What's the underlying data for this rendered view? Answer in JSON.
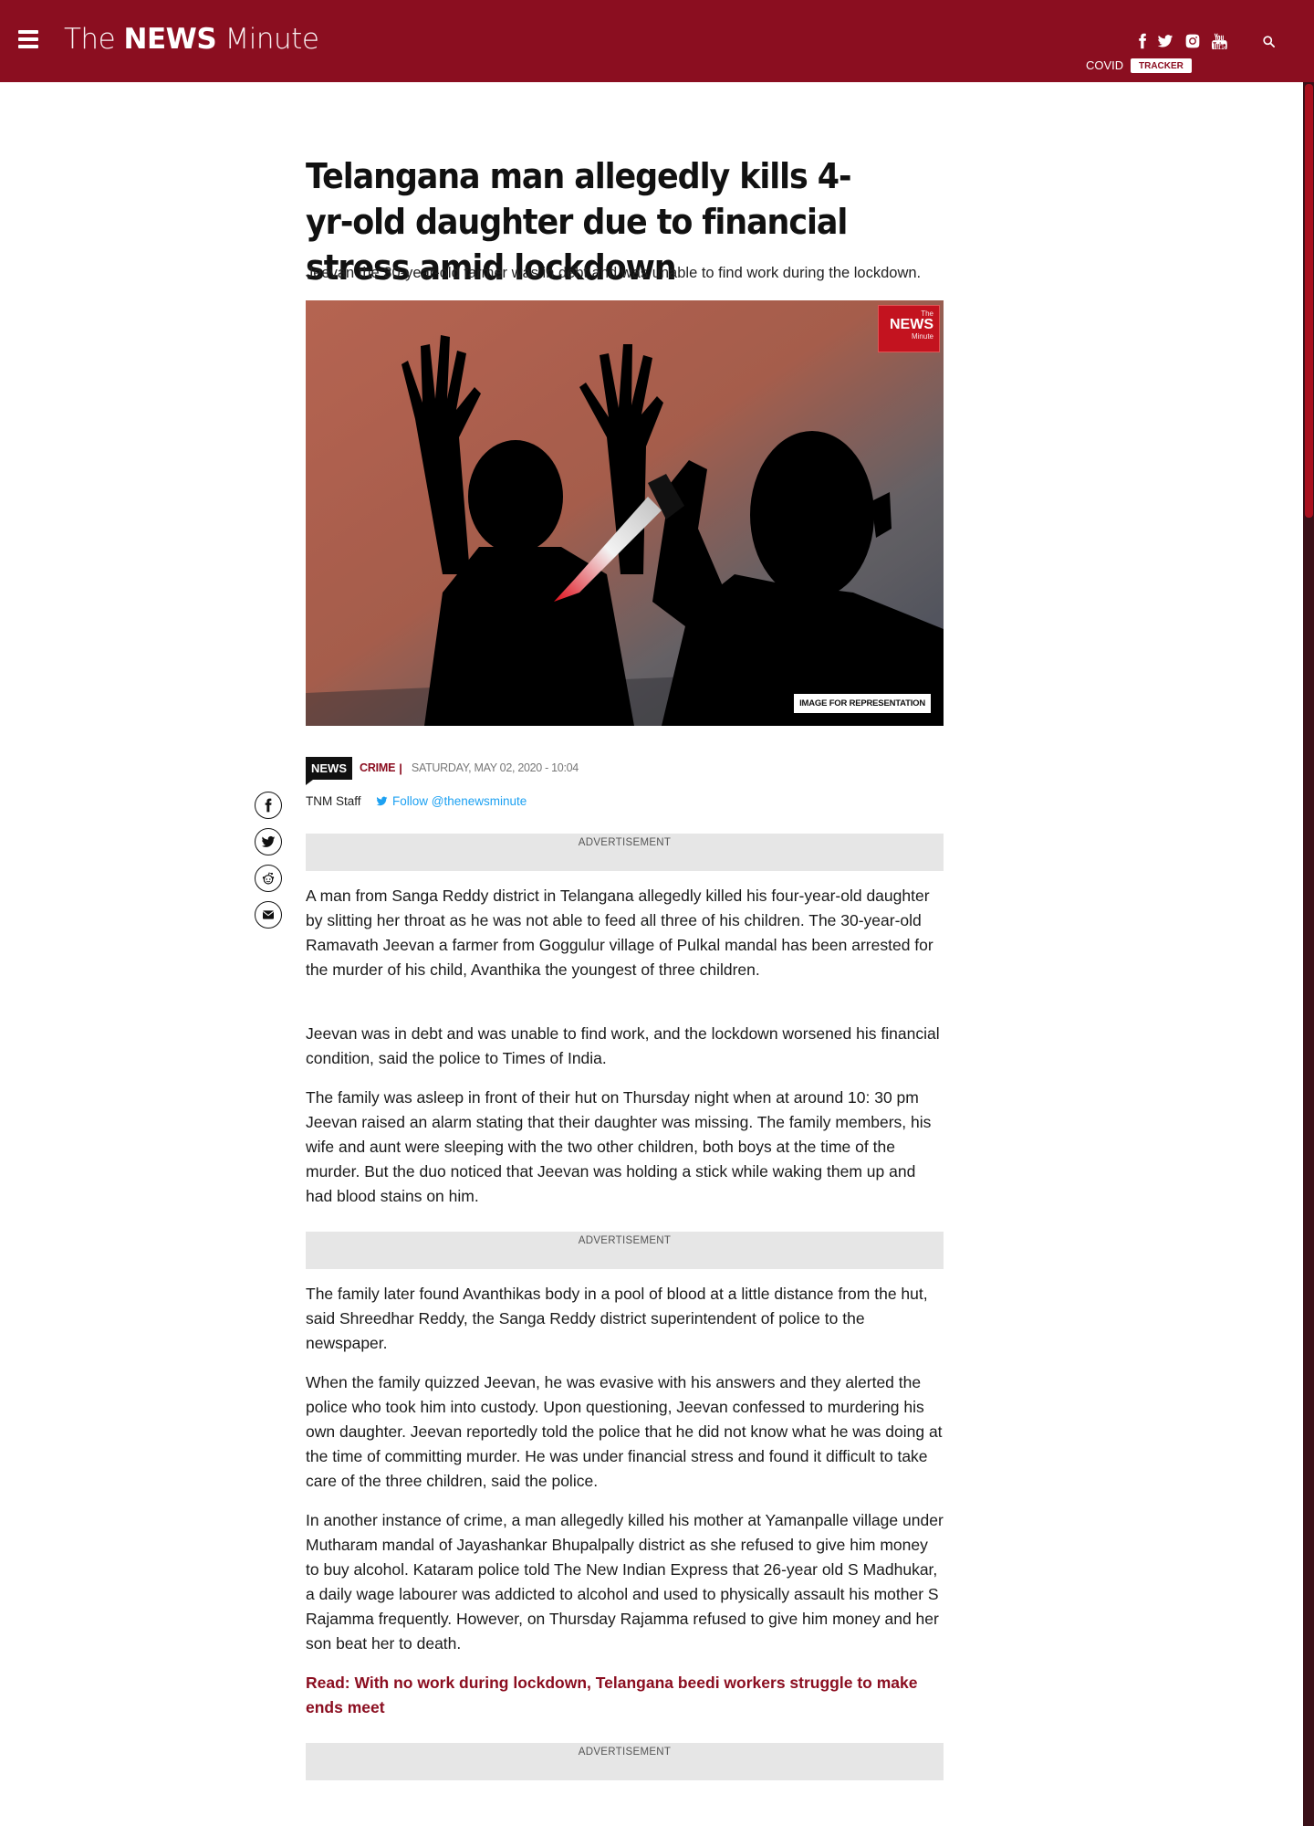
{
  "header": {
    "logo_the": "The",
    "logo_news": "NEWS",
    "logo_minute": "Minute",
    "covid_label": "COVID",
    "tracker_label": "TRACKER",
    "social_icons": [
      "facebook-icon",
      "twitter-icon",
      "instagram-icon",
      "youtube-icon"
    ],
    "search_icon": "search-icon",
    "menu_icon": "hamburger-menu-icon",
    "brand_color": "#8b0e20"
  },
  "article": {
    "headline": "Telangana man allegedly kills 4-yr-old daughter due to financial stress amid lockdown",
    "subhead": "Jeevan the 30-year-old farmer was in debt and was unable to find work during the lockdown.",
    "image_caption": "IMAGE FOR REPRESENTATION",
    "watermark_the": "The",
    "watermark_news": "NEWS",
    "watermark_minute": "Minute",
    "badge": "NEWS",
    "category": "CRIME",
    "separator": "|",
    "date": "SATURDAY, MAY 02, 2020 - 10:04",
    "author": "TNM Staff",
    "follow": "Follow @thenewsminute",
    "ad_label": "ADVERTISEMENT",
    "paragraphs": [
      "A man from Sanga Reddy district in Telangana allegedly killed his four-year-old daughter by slitting her throat as he was not able to feed all three of his children. The 30-year-old Ramavath Jeevan a farmer from Goggulur village of Pulkal mandal has been arrested for the murder of his child, Avanthika the youngest of three children.",
      "Jeevan was in debt and was unable to find work, and the lockdown worsened his financial condition, said the police to Times of India.",
      "The family was asleep in front of their hut on Thursday night when at around 10: 30 pm Jeevan raised an alarm stating that their daughter was missing. The family members, his wife and aunt were sleeping with the two other children, both boys at the time of the murder. But the duo noticed that Jeevan was holding a stick while waking them up and had blood stains on him.",
      "The family later found Avanthikas body in a pool of blood at a little distance from the hut, said Shreedhar Reddy, the Sanga Reddy district superintendent of police to the newspaper.",
      "When the family quizzed Jeevan, he was evasive with his answers and they alerted the police who took him into custody. Upon questioning, Jeevan confessed to murdering his own daughter. Jeevan reportedly told the police that he did not know what he was doing at the time of committing murder. He was under financial stress and found it difficult to take care of the three children, said the police.",
      "In another instance of crime, a man allegedly killed his mother at Yamanpalle village under Mutharam mandal of Jayashankar Bhupalpally district as she refused to give him money to buy alcohol. Kataram police told The New Indian Express that 26-year old S Madhukar, a daily wage labourer was addicted to alcohol and used to physically assault his mother S Rajamma frequently. However, on Thursday Rajamma refused to give him money and her son beat her to death."
    ],
    "read_link": "Read: With no work during lockdown, Telangana beedi workers struggle to make ends meet",
    "share_icons": [
      "facebook-share-icon",
      "twitter-share-icon",
      "reddit-share-icon",
      "email-share-icon"
    ]
  }
}
